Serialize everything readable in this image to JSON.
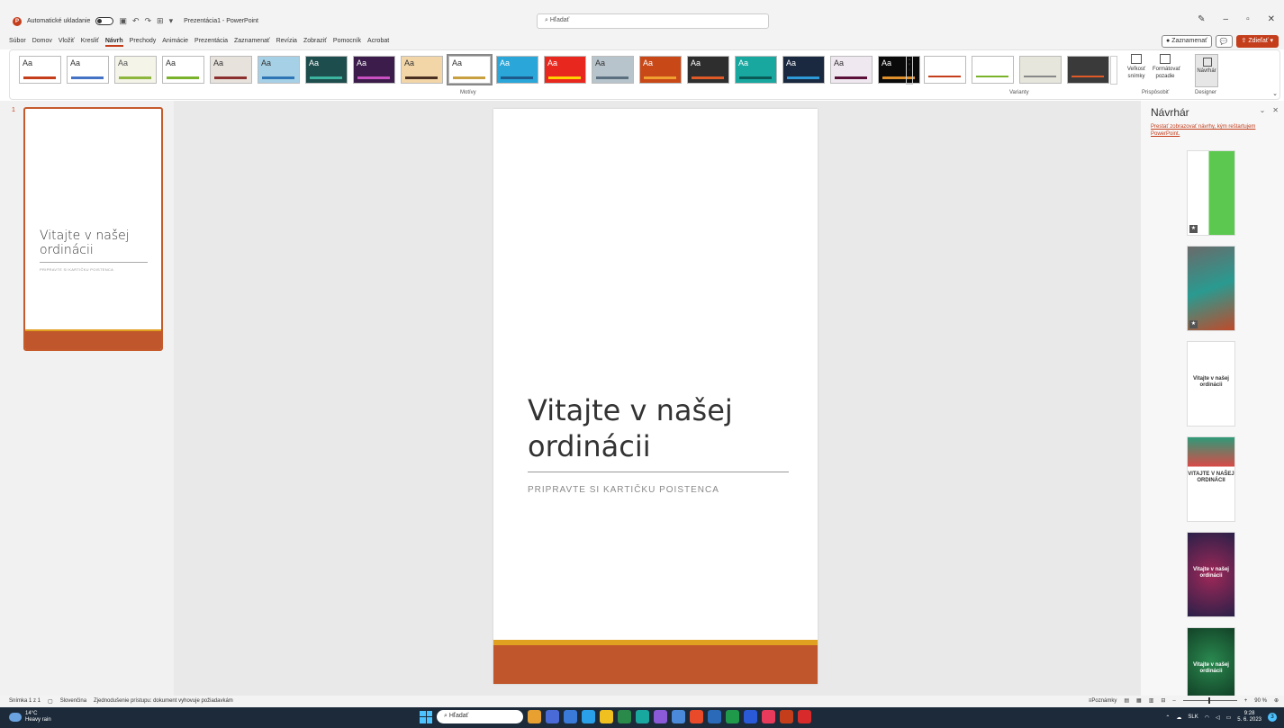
{
  "titlebar": {
    "autosave_label": "Automatické ukladanie",
    "doc_title": "Prezentácia1 - PowerPoint",
    "search_placeholder": "Hľadať"
  },
  "menu": {
    "items": [
      "Súbor",
      "Domov",
      "Vložiť",
      "Kresliť",
      "Návrh",
      "Prechody",
      "Animácie",
      "Prezentácia",
      "Zaznamenať",
      "Revízia",
      "Zobraziť",
      "Pomocník",
      "Acrobat"
    ],
    "active": "Návrh",
    "record_label": "Zaznamenať",
    "share_label": "Zdieľať"
  },
  "ribbon": {
    "themes_group_label": "Motívy",
    "variants_group_label": "Varianty",
    "customize_group_label": "Prispôsobiť",
    "designer_group_label": "Designer",
    "slide_size_label": "Veľkosť snímky",
    "format_bg_label": "Formátovať pozadie",
    "designer_button_label": "Návrhár",
    "theme_text": "Aa",
    "themes": [
      {
        "bg": "#ffffff",
        "accent": "#c43e1c",
        "text": "#333333"
      },
      {
        "bg": "#ffffff",
        "accent": "#4472c4",
        "text": "#333333"
      },
      {
        "bg": "#f4f4e8",
        "accent": "#8cb63c",
        "text": "#555555"
      },
      {
        "bg": "#ffffff",
        "accent": "#7ab32b",
        "text": "#333333"
      },
      {
        "bg": "#e8e2dc",
        "accent": "#8c2f2f",
        "text": "#333333"
      },
      {
        "bg": "#a6d0e6",
        "accent": "#2e75b6",
        "text": "#333333"
      },
      {
        "bg": "#1e4d4d",
        "accent": "#3cb4a0",
        "text": "#ffffff"
      },
      {
        "bg": "#3b1c4a",
        "accent": "#c850c0",
        "text": "#ffffff"
      },
      {
        "bg": "#f2d6a8",
        "accent": "#4a3020",
        "text": "#333333"
      },
      {
        "bg": "#ffffff",
        "accent": "#c8a040",
        "text": "#333333"
      },
      {
        "bg": "#2aa6d8",
        "accent": "#1e5a8c",
        "text": "#ffffff"
      },
      {
        "bg": "#e8281e",
        "accent": "#ffd200",
        "text": "#ffffff"
      },
      {
        "bg": "#b8c4cc",
        "accent": "#5a7080",
        "text": "#333333"
      },
      {
        "bg": "#c84818",
        "accent": "#f0a030",
        "text": "#ffffff"
      },
      {
        "bg": "#2e2e2e",
        "accent": "#e05a28",
        "text": "#ffffff"
      },
      {
        "bg": "#18a8a0",
        "accent": "#0a5a58",
        "text": "#ffffff"
      },
      {
        "bg": "#1a2840",
        "accent": "#2e9ad8",
        "text": "#ffffff"
      },
      {
        "bg": "#f0e8f0",
        "accent": "#5a1038",
        "text": "#333333"
      },
      {
        "bg": "#0a0a0a",
        "accent": "#e0902a",
        "text": "#ffffff"
      }
    ],
    "variants": [
      {
        "bg": "#ffffff",
        "accent": "#c43e1c"
      },
      {
        "bg": "#ffffff",
        "accent": "#7ab32b"
      },
      {
        "bg": "#e6e6dc",
        "accent": "#888888"
      },
      {
        "bg": "#3a3a3a",
        "accent": "#e05a28"
      }
    ]
  },
  "thumbnails": {
    "number": "1",
    "title": "Vitajte v našej ordinácii",
    "subtitle": "PRIPRAVTE SI KARTIČKU POISTENCA"
  },
  "slide": {
    "title": "Vitajte v našej ordinácii",
    "subtitle": "PRIPRAVTE SI KARTIČKU POISTENCA",
    "accent1": "#e0a020",
    "accent2": "#c0562b"
  },
  "designer": {
    "title": "Návrhár",
    "stop_link": "Prestať zobrazovať návrhy, kým reštartujem PowerPoint.",
    "cards": [
      {
        "text": "",
        "bg": "linear-gradient(90deg,#ffffff 45%,#5cc850 45%)"
      },
      {
        "text": "",
        "bg": "linear-gradient(160deg,#6a6a6a,#2a9a90 50%,#c04a2a)"
      },
      {
        "text": "Vitajte v našej ordinácii",
        "bg": "#ffffff"
      },
      {
        "text": "VITAJTE V NAŠEJ ORDINÁCII",
        "bg": "linear-gradient(180deg,#2e9a78 0%,#d84a48 35%,#ffffff 35%)"
      },
      {
        "text": "Vitajte v našej ordinácii",
        "bg": "radial-gradient(circle,#a02858,#2a2048)"
      },
      {
        "text": "Vitajte v našej ordinácii",
        "bg": "radial-gradient(circle at 50% 40%,#2a8a50,#0a2818)"
      }
    ]
  },
  "statusbar": {
    "slide_count": "Snímka 1 z 1",
    "language": "Slovenčina",
    "accessibility": "Zjednodušenie prístupu: dokument vyhovuje požiadavkám",
    "notes_label": "Poznámky",
    "zoom": "90 %"
  },
  "taskbar": {
    "temp": "14°C",
    "weather": "Heavy rain",
    "search_placeholder": "Hľadať",
    "lang": "SLK",
    "time": "9:28",
    "date": "5. 6. 2023",
    "notif_count": "3",
    "apps": [
      "#e8a030",
      "#4a6ad8",
      "#3a7ad8",
      "#2aa0e8",
      "#f0c020",
      "#2a8a4a",
      "#18a8a0",
      "#8a5ad8",
      "#4a8ad8",
      "#e84a2a",
      "#2a6ab8",
      "#1e9a4a",
      "#2a5ad8",
      "#e83a5a",
      "#c43e1c",
      "#d82a2a"
    ]
  }
}
